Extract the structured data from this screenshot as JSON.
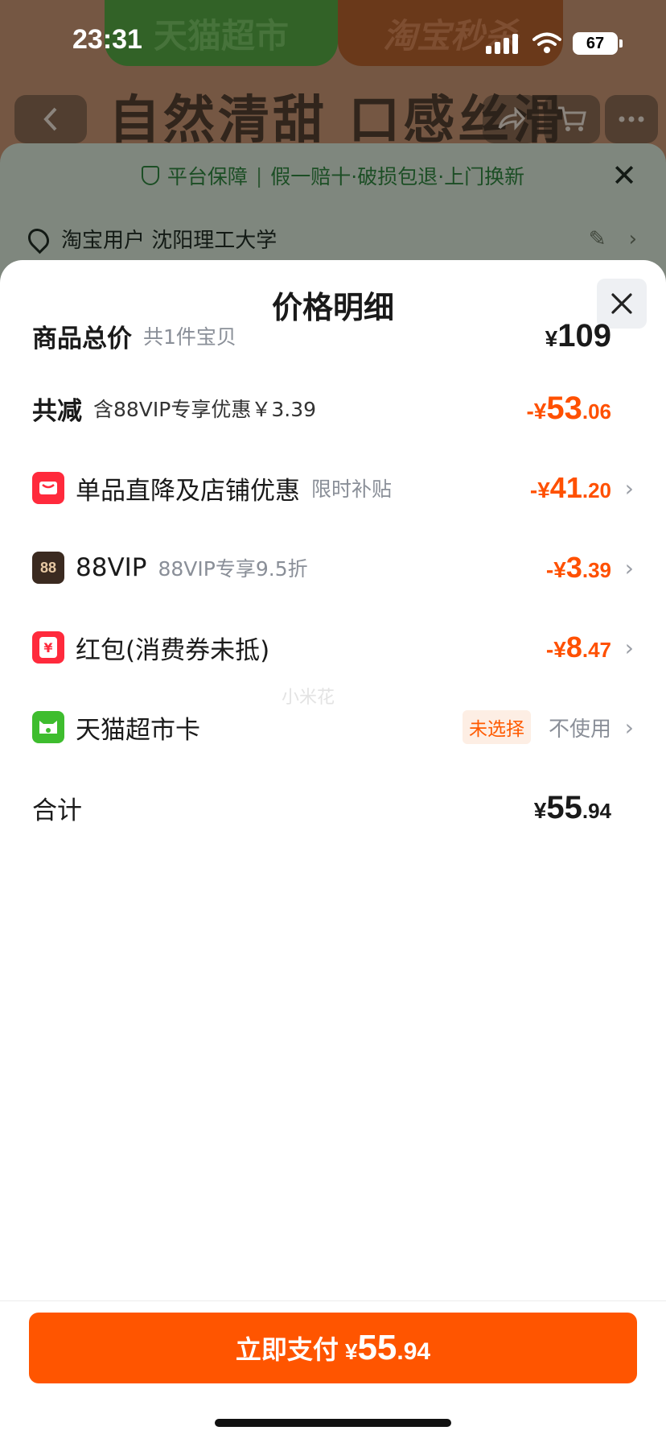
{
  "status_bar": {
    "time": "23:31",
    "battery": "67"
  },
  "background": {
    "tab_left": "天猫超市",
    "tab_right": "淘宝秒杀",
    "slogan": "自然清甜 口感丝滑",
    "assurance": {
      "title": "平台保障",
      "detail": "假一赔十·破损包退·上门换新"
    },
    "address": "淘宝用户 沈阳理工大学"
  },
  "modal": {
    "title": "价格明细",
    "total_goods": {
      "label": "商品总价",
      "sub": "共1件宝贝",
      "currency": "¥",
      "int": "109"
    },
    "total_discount": {
      "label": "共减",
      "sub": "含88VIP专享优惠￥3.39",
      "prefix": "-¥",
      "int": "53",
      "dec": ".06"
    },
    "items": [
      {
        "label": "单品直降及店铺优惠",
        "sub": "限时补贴",
        "prefix": "-¥",
        "int": "41",
        "dec": ".20"
      },
      {
        "label": "88VIP",
        "sub": "88VIP专享9.5折",
        "icon_text": "88",
        "prefix": "-¥",
        "int": "3",
        "dec": ".39"
      },
      {
        "label": "红包(消费券未抵)",
        "sub": "",
        "icon_text": "¥",
        "prefix": "-¥",
        "int": "8",
        "dec": ".47"
      }
    ],
    "tmall_card": {
      "label": "天猫超市卡",
      "tag": "未选择",
      "action": "不使用"
    },
    "total": {
      "label": "合计",
      "currency": "¥",
      "int": "55",
      "dec": ".94"
    },
    "watermark": "小米花"
  },
  "pay": {
    "label": "立即支付",
    "currency": "¥",
    "int": "55",
    "dec": ".94"
  },
  "colors": {
    "accent": "#ff5500",
    "discount": "#ff5000"
  }
}
